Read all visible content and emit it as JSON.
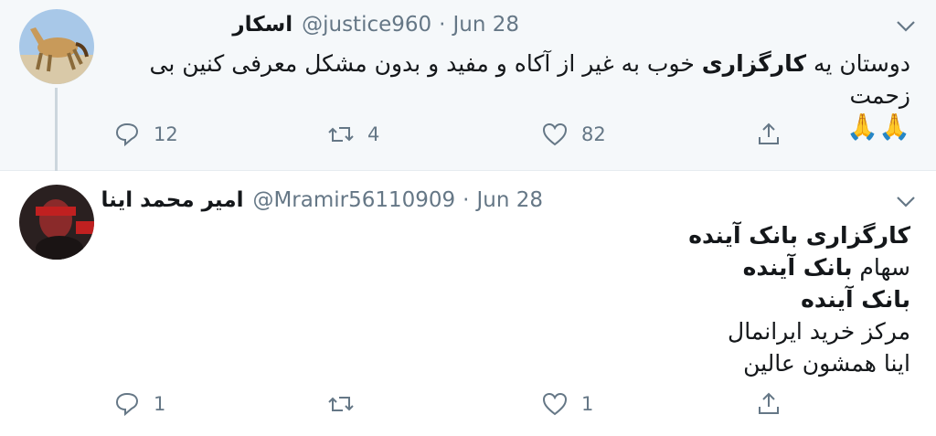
{
  "tweet1": {
    "display_name": "اسکار",
    "handle": "@justice960",
    "separator": "·",
    "date": "Jun 28",
    "text_bold": "کارگزاری",
    "text_before": "دوستان یه ",
    "text_after": " خوب به غیر از آکاه و مفید و بدون مشکل معرفی کنین بی زحمت",
    "emoji": "🙏🙏",
    "replies": "12",
    "retweets": "4",
    "likes": "82"
  },
  "tweet2": {
    "display_name": "امیر محمد اینا",
    "handle": "@Mramir56110909",
    "separator": "·",
    "date": "Jun 28",
    "line1": "کارگزاری بانک آینده",
    "line2_prefix": "سهام ",
    "line2_bold": "بانک آینده",
    "line3": "بانک آینده",
    "line4": "مرکز خرید ایرانمال",
    "line5": "اینا همشون عالین",
    "replies": "1",
    "retweets": "",
    "likes": "1"
  },
  "colors": {
    "muted": "#657786",
    "bg_parent": "#f5f8fa",
    "thread": "#ccd6dd"
  },
  "icons": [
    "reply-icon",
    "retweet-icon",
    "like-icon",
    "share-icon",
    "chevron-down-icon"
  ]
}
